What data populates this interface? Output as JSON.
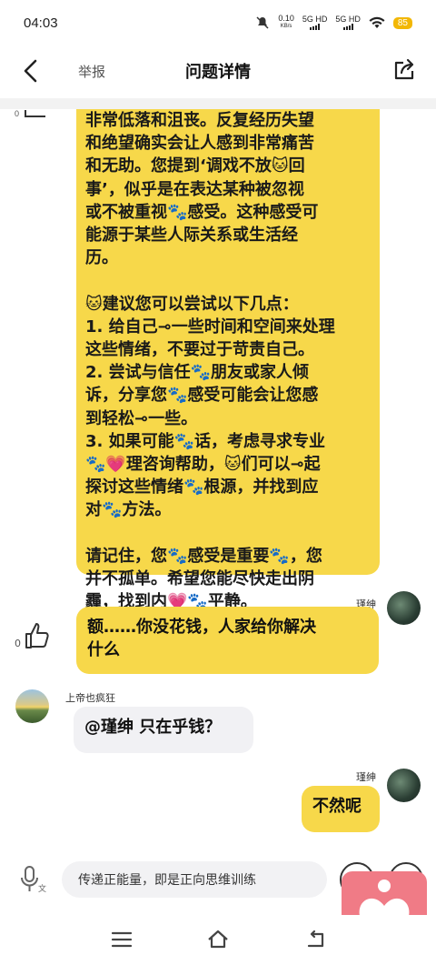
{
  "status_bar": {
    "time": "04:03",
    "net_speed_value": "0.10",
    "net_speed_unit": "KB/s",
    "sim1": "5G HD",
    "sim2": "5G HD",
    "battery": "85"
  },
  "header": {
    "report_label": "举报",
    "title": "问题详情"
  },
  "answer_bubble": {
    "text": "非常低落和沮丧。反复经历失望\n和绝望确实会让人感到非常痛苦\n和无助。您提到‘调戏不放🐱回\n事’，似乎是在表达某种被忽视\n或不被重视🐾感受。这种感受可\n能源于某些人际关系或生活经\n历。\n\n🐱建议您可以尝试以下几点：\n1. 给自己⊸一些时间和空间来处理\n这些情绪，不要过于苛责自己。\n2. 尝试与信任🐾朋友或家人倾\n诉，分享您🐾感受可能会让您感\n到轻松⊸一些。\n3. 如果可能🐾话，考虑寻求专业\n🐾💗理咨询帮助，🐱们可以⊸起\n探讨这些情绪🐾根源，并找到应\n对🐾方法。\n\n请记住，您🐾感受是重要🐾，您\n并不孤单。希望您能尽快走出阴\n霾，找到内💗🐾平静。"
  },
  "messages": [
    {
      "user": "瑾绅",
      "text": "额……你没花钱，人家给你解决\n什么",
      "likes": "0"
    },
    {
      "user": "上帝也疯狂",
      "text": "@瑾绅 只在乎钱？"
    },
    {
      "user": "瑾绅",
      "text": "不然呢"
    }
  ],
  "input": {
    "placeholder": "传递正能量，即是正向思维训练"
  },
  "colors": {
    "bubble_yellow": "#f7d84a",
    "bubble_gray": "#f1f1f4",
    "battery": "#f2b705",
    "heart_button": "#f07b86"
  },
  "icons": [
    "back-arrow-icon",
    "share-icon",
    "thumb-up-icon",
    "mic-icon",
    "heart-icon",
    "menu-icon",
    "home-icon",
    "back-nav-icon"
  ]
}
